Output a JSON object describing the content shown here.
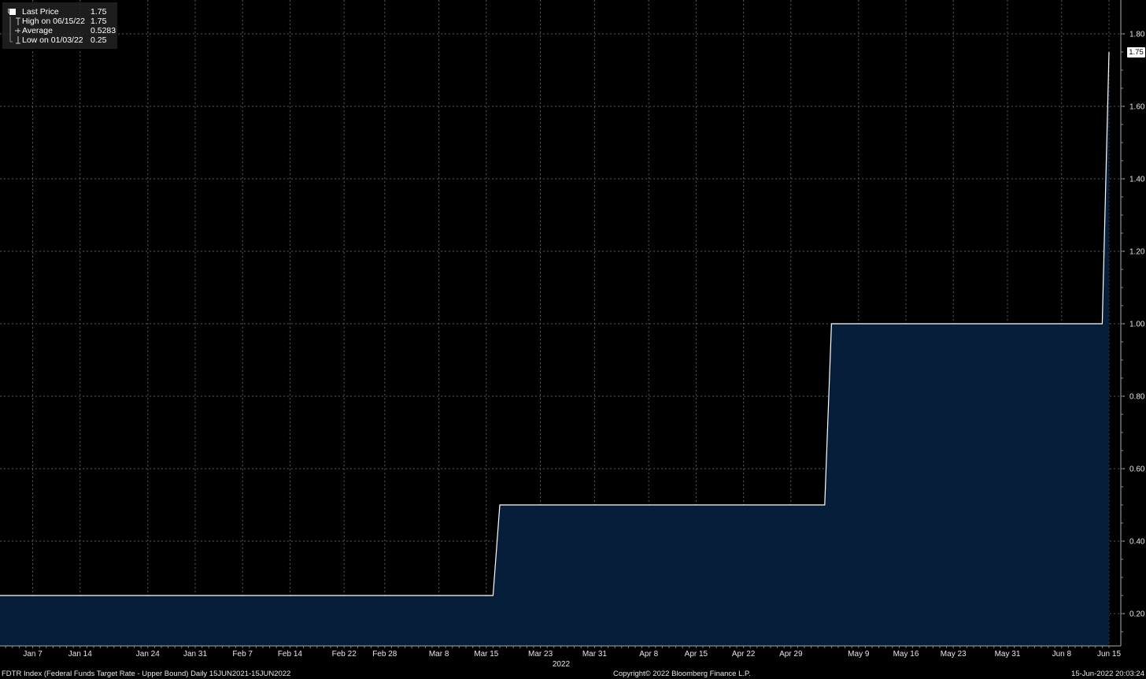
{
  "legend": {
    "last_price_label": "Last Price",
    "last_price_value": "1.75",
    "high_label": "High on 06/15/22",
    "high_value": "1.75",
    "average_label": "Average",
    "average_value": "0.5283",
    "low_label": "Low on 01/03/22",
    "low_value": "0.25"
  },
  "last_value_tag": "1.75",
  "footer": {
    "left": "FDTR Index (Federal Funds Target Rate - Upper Bound)  Daily 15JUN2021-15JUN2022",
    "center": "Copyright© 2022 Bloomberg Finance L.P.",
    "right": "15-Jun-2022 20:03:24"
  },
  "colors": {
    "background": "#000000",
    "fill": "#071e3a",
    "line": "#ffffff",
    "grid": "#5a5a5a"
  },
  "chart_data": {
    "type": "area",
    "series": [
      {
        "name": "Last Price",
        "x": [
          "2022-01-03",
          "2022-03-16",
          "2022-03-17",
          "2022-05-04",
          "2022-05-05",
          "2022-06-14",
          "2022-06-15"
        ],
        "values": [
          0.25,
          0.25,
          0.5,
          0.5,
          1.0,
          1.0,
          1.75
        ]
      }
    ],
    "x_range": [
      "2022-01-03",
      "2022-06-15"
    ],
    "x_ticks": [
      "2022-01-07",
      "2022-01-14",
      "2022-01-24",
      "2022-01-31",
      "2022-02-07",
      "2022-02-14",
      "2022-02-22",
      "2022-02-28",
      "2022-03-08",
      "2022-03-15",
      "2022-03-23",
      "2022-03-31",
      "2022-04-08",
      "2022-04-15",
      "2022-04-22",
      "2022-04-29",
      "2022-05-09",
      "2022-05-16",
      "2022-05-23",
      "2022-05-31",
      "2022-06-08",
      "2022-06-15"
    ],
    "x_tick_labels": [
      "Jan 7",
      "Jan 14",
      "Jan 24",
      "Jan 31",
      "Feb 7",
      "Feb 14",
      "Feb 22",
      "Feb 28",
      "Mar 8",
      "Mar 15",
      "Mar 23",
      "Mar 31",
      "Apr 8",
      "Apr 15",
      "Apr 22",
      "Apr 29",
      "May 9",
      "May 16",
      "May 23",
      "May 31",
      "Jun 8",
      "Jun 15"
    ],
    "year_label": "2022",
    "ylim": [
      0.15,
      1.82
    ],
    "y_ticks": [
      0.2,
      0.4,
      0.6,
      0.8,
      1.0,
      1.2,
      1.4,
      1.6,
      1.8
    ],
    "y_tick_labels": [
      "0.20",
      "0.40",
      "0.60",
      "0.80",
      "1.00",
      "1.20",
      "1.40",
      "1.60",
      "1.80"
    ],
    "grid": true,
    "y_axis_position": "right"
  }
}
